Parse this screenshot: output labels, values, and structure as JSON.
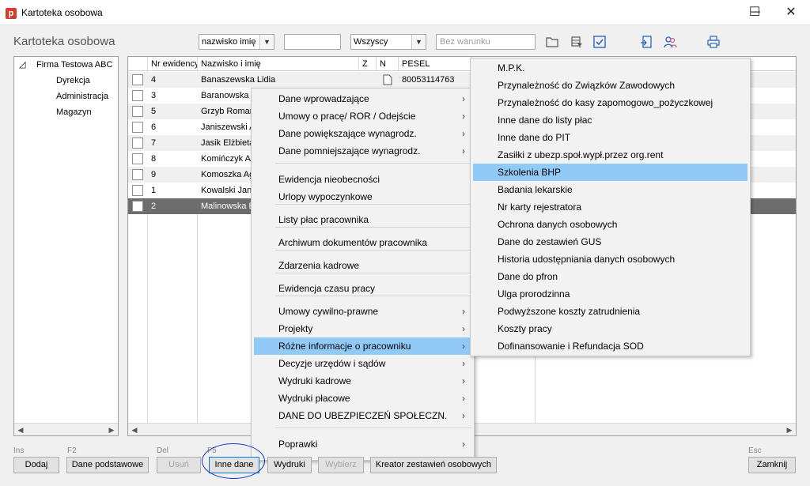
{
  "window": {
    "app_icon_letter": "p",
    "title": "Kartoteka osobowa",
    "minimize": "─",
    "maximize": "☐",
    "close": "✕"
  },
  "header": {
    "title": "Kartoteka osobowa",
    "sort_combo": "nazwisko imię",
    "search_value": "",
    "filter_combo": "Wszyscy",
    "condition_placeholder": "Bez warunku"
  },
  "toolbar_icons": [
    "folder-icon",
    "filter-table-icon",
    "check-box-icon",
    "export-icon",
    "users-icon",
    "printer-icon"
  ],
  "tree": {
    "root": "Firma Testowa ABC",
    "children": [
      "Dyrekcja",
      "Administracja",
      "Magazyn"
    ]
  },
  "grid": {
    "columns": [
      "Nr ewidencyjny",
      "Nazwisko i imię",
      "Z",
      "N",
      "PESEL"
    ],
    "rows": [
      {
        "nr": "4",
        "name": "Banaszewska Lidia",
        "pesel": "80053114763"
      },
      {
        "nr": "3",
        "name": "Baranowska",
        "pesel": ""
      },
      {
        "nr": "5",
        "name": "Grzyb Roman",
        "pesel": ""
      },
      {
        "nr": "6",
        "name": "Janiszewski A",
        "pesel": ""
      },
      {
        "nr": "7",
        "name": "Jasik Elżbieta",
        "pesel": ""
      },
      {
        "nr": "8",
        "name": "Komińczyk A",
        "pesel": ""
      },
      {
        "nr": "9",
        "name": "Komoszka Ag",
        "pesel": ""
      },
      {
        "nr": "1",
        "name": "Kowalski Jan",
        "pesel": ""
      },
      {
        "nr": "2",
        "name": "Malinowska E",
        "pesel": ""
      }
    ],
    "selected_row": 8
  },
  "context_menu": {
    "items": [
      {
        "label": "Dane wprowadzające",
        "sub": true
      },
      {
        "label": "Umowy o pracę/ ROR / Odejście",
        "sub": true
      },
      {
        "label": "Dane powiększające wynagrodz.",
        "sub": true
      },
      {
        "label": "Dane pomniejszające wynagrodz.",
        "sub": true
      },
      {
        "label": "Ewidencja nieobecności",
        "sub": false
      },
      {
        "label": "Urlopy wypoczynkowe",
        "sub": false
      },
      {
        "label": "Listy płac pracownika",
        "sub": false
      },
      {
        "label": "Archiwum dokumentów pracownika",
        "sub": false
      },
      {
        "label": "Zdarzenia kadrowe",
        "sub": false
      },
      {
        "label": "Ewidencja czasu pracy",
        "sub": false
      },
      {
        "label": "Umowy cywilno-prawne",
        "sub": true
      },
      {
        "label": "Projekty",
        "sub": true
      },
      {
        "label": "Różne informacje o pracowniku",
        "sub": true
      },
      {
        "label": "Decyzje urzędów i sądów",
        "sub": true
      },
      {
        "label": "Wydruki kadrowe",
        "sub": true
      },
      {
        "label": "Wydruki płacowe",
        "sub": true
      },
      {
        "label": "DANE DO UBEZPIECZEŃ SPOŁECZN.",
        "sub": true
      },
      {
        "label": "Poprawki",
        "sub": true
      }
    ],
    "highlighted": 12,
    "submenu_arrow": "›"
  },
  "submenu": {
    "items": [
      "M.P.K.",
      "Przynależność do Związków Zawodowych",
      "Przynależność do kasy zapomogowo_pożyczkowej",
      "Inne dane do listy płac",
      "Inne dane do PIT",
      "Zasiłki z ubezp.społ.wypł.przez org.rent",
      "Szkolenia BHP",
      "Badania lekarskie",
      "Nr karty rejestratora",
      "Ochrona danych osobowych",
      "Dane do zestawień GUS",
      "Historia udostępniania danych osobowych",
      "Dane do pfron",
      "Ulga prorodzinna",
      "Podwyższone koszty zatrudnienia",
      "Koszty pracy",
      "Dofinansowanie i Refundacja SOD"
    ],
    "highlighted": 6
  },
  "footer": {
    "keys": {
      "ins": "Ins",
      "f2": "F2",
      "del": "Del",
      "f5": "F5",
      "esc": "Esc"
    },
    "buttons": {
      "dodaj": "Dodaj",
      "dane_podstawowe": "Dane podstawowe",
      "usun": "Usuń",
      "inne_dane": "Inne dane",
      "wydruki": "Wydruki",
      "wybierz": "Wybierz",
      "kreator": "Kreator zestawień osobowych",
      "zamknij": "Zamknij"
    }
  },
  "colors": {
    "menu_highlight": "#91c9f7",
    "row_selected": "#6d6d6d",
    "annotation_ellipse": "#1a2fcf",
    "app_icon": "#d83b2b"
  }
}
